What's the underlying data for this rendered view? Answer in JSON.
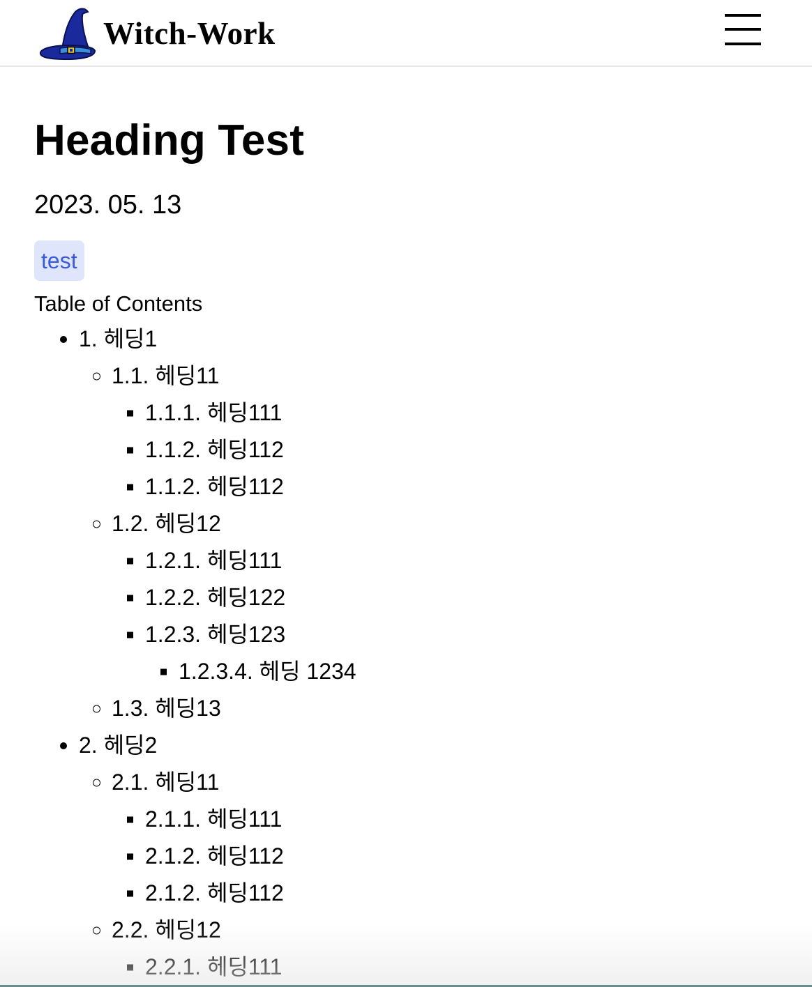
{
  "header": {
    "site_title": "Witch-Work",
    "logo_icon": "witch-hat-icon",
    "menu_icon": "hamburger-menu-icon"
  },
  "post": {
    "title": "Heading Test",
    "date": "2023. 05. 13",
    "tags": [
      "test"
    ],
    "toc_title": "Table of Contents",
    "toc": [
      {
        "level": 1,
        "text": "1. 헤딩1"
      },
      {
        "level": 2,
        "text": "1.1. 헤딩11"
      },
      {
        "level": 3,
        "text": "1.1.1. 헤딩111"
      },
      {
        "level": 3,
        "text": "1.1.2. 헤딩112"
      },
      {
        "level": 3,
        "text": "1.1.2. 헤딩112"
      },
      {
        "level": 2,
        "text": "1.2. 헤딩12"
      },
      {
        "level": 3,
        "text": "1.2.1. 헤딩111"
      },
      {
        "level": 3,
        "text": "1.2.2. 헤딩122"
      },
      {
        "level": 3,
        "text": "1.2.3. 헤딩123"
      },
      {
        "level": 4,
        "text": "1.2.3.4. 헤딩 1234"
      },
      {
        "level": 2,
        "text": "1.3. 헤딩13"
      },
      {
        "level": 1,
        "text": "2. 헤딩2"
      },
      {
        "level": 2,
        "text": "2.1. 헤딩11"
      },
      {
        "level": 3,
        "text": "2.1.1. 헤딩111"
      },
      {
        "level": 3,
        "text": "2.1.2. 헤딩112"
      },
      {
        "level": 3,
        "text": "2.1.2. 헤딩112"
      },
      {
        "level": 2,
        "text": "2.2. 헤딩12"
      },
      {
        "level": 3,
        "text": "2.2.1. 헤딩111"
      }
    ]
  },
  "colors": {
    "tag_background": "#dfe6fb",
    "tag_text": "#3b5bd6",
    "hat_blue": "#1a2a9c",
    "hat_brim_band": "#3a8fd8"
  }
}
